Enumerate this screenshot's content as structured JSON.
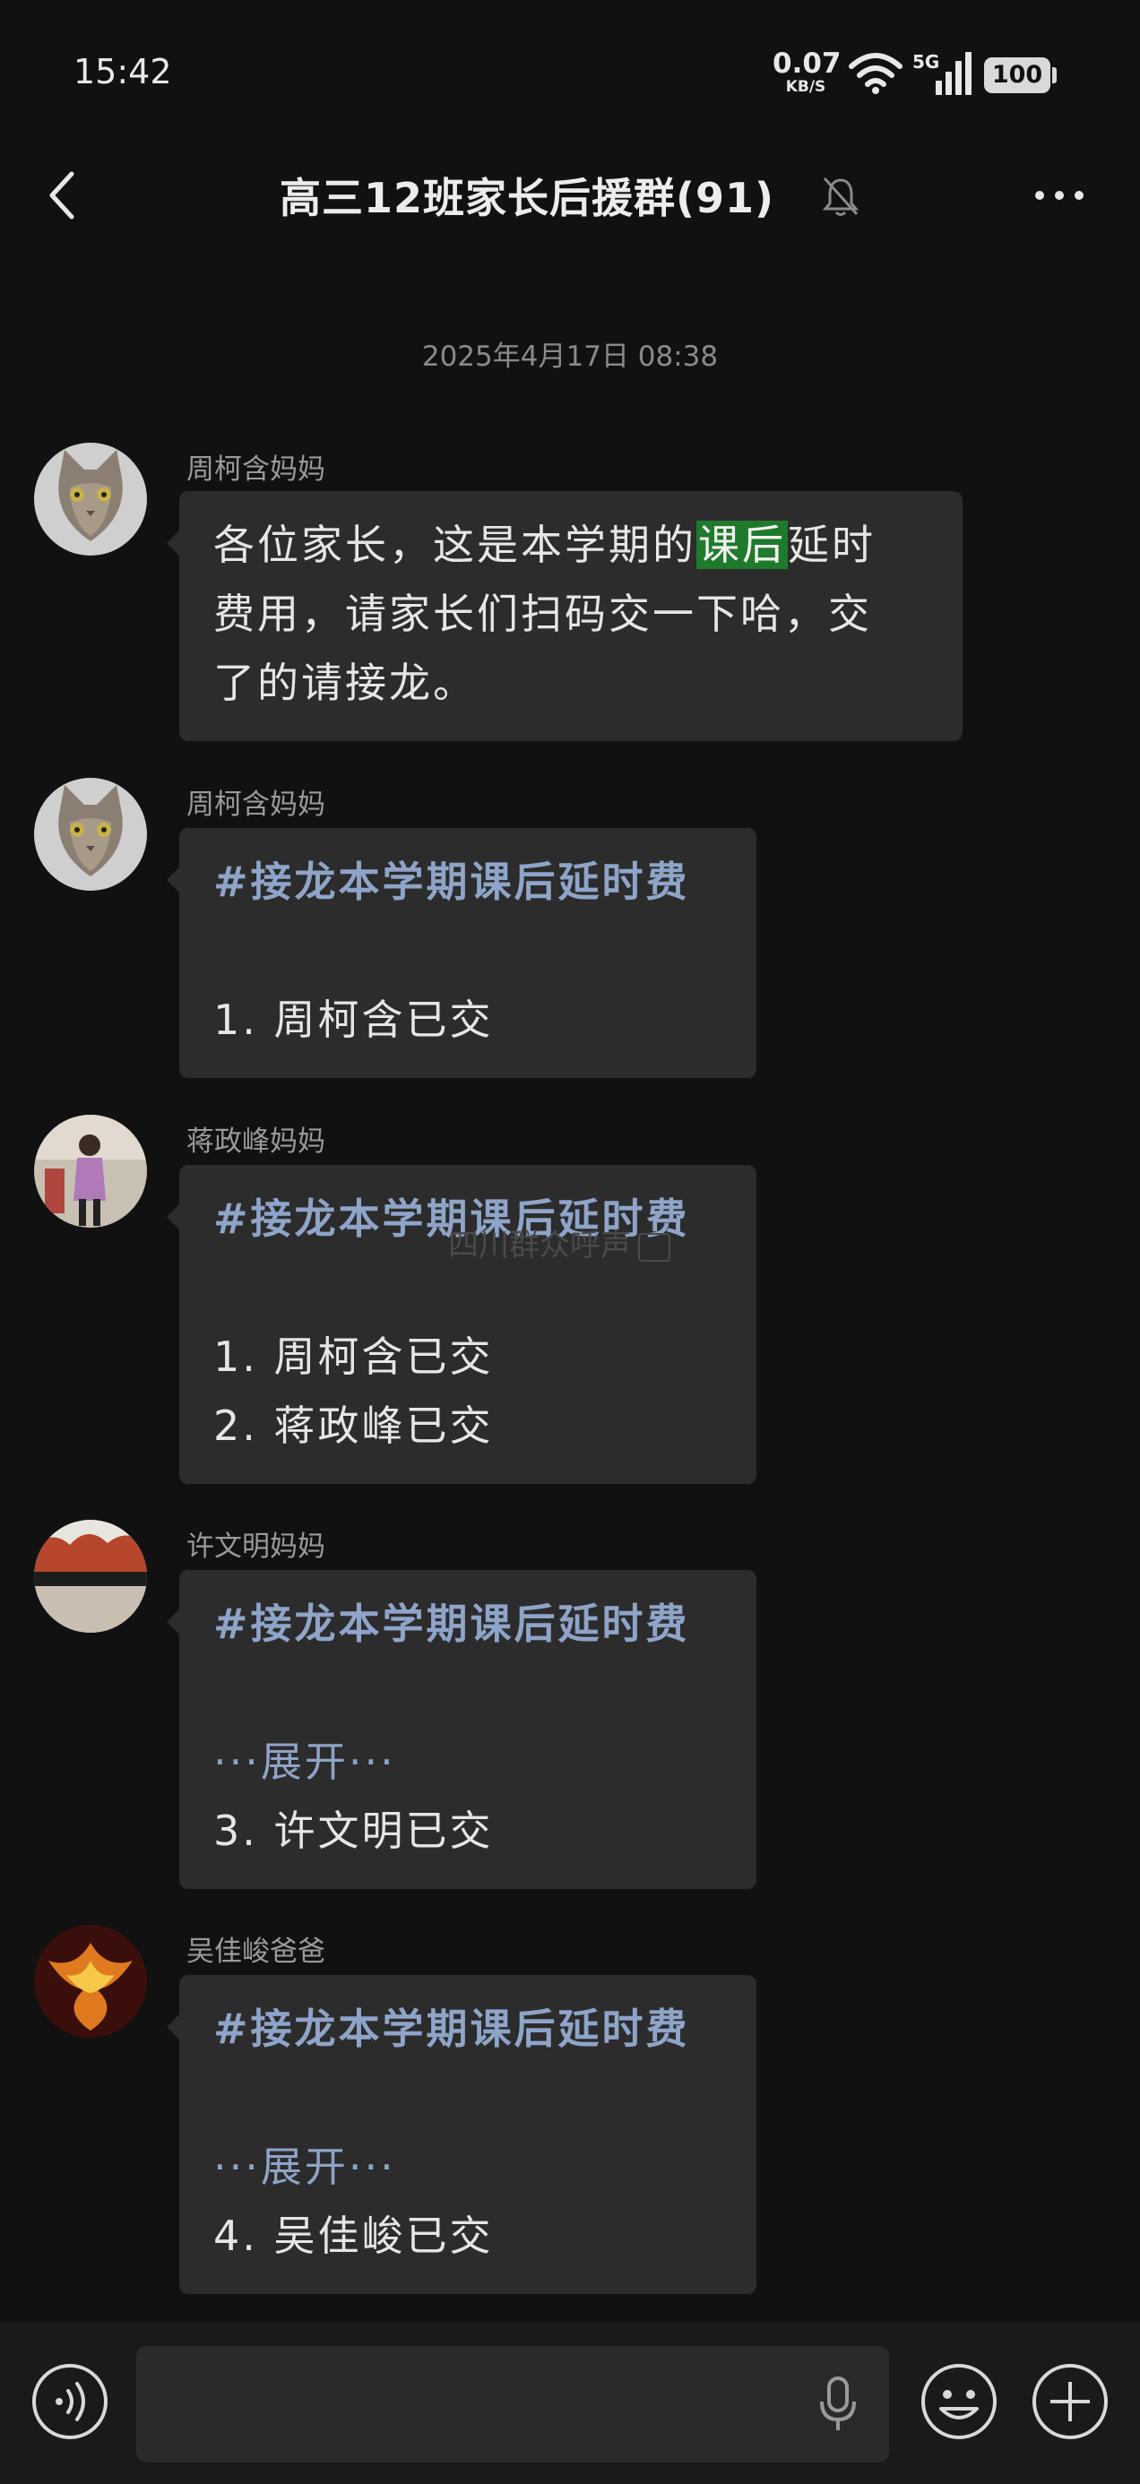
{
  "status_bar": {
    "time": "15:42",
    "net_speed_value": "0.07",
    "net_speed_unit": "KB/S",
    "signal_label": "5G",
    "battery": "100"
  },
  "header": {
    "title": "高三12班家长后援群(91)",
    "icons": [
      "back-icon",
      "mute-bell-icon",
      "more-icon"
    ]
  },
  "chat": {
    "timestamp": "2025年4月17日 08:38",
    "messages": [
      {
        "sender": "周柯含妈妈",
        "line1_pre": "各位家长，这是本学期的",
        "line1_highlight": "课后",
        "line1_post": "延时",
        "line2": "费用，请家长们扫码交一下哈，交",
        "line3": "了的请接龙。"
      },
      {
        "sender": "周柯含妈妈",
        "tag": "#接龙本学期课后延时费",
        "entries": [
          "1. 周柯含已交"
        ]
      },
      {
        "sender": "蒋政峰妈妈",
        "tag": "#接龙本学期课后延时费",
        "entries": [
          "1. 周柯含已交",
          "2. 蒋政峰已交"
        ]
      },
      {
        "sender": "许文明妈妈",
        "tag": "#接龙本学期课后延时费",
        "expand": "···展开···",
        "entries": [
          "3. 许文明已交"
        ]
      },
      {
        "sender": "吴佳峻爸爸",
        "tag": "#接龙本学期课后延时费",
        "expand": "···展开···",
        "entries": [
          "4. 吴佳峻已交"
        ]
      }
    ]
  },
  "watermark": "四川群众呼声",
  "input_bar": {
    "icons": [
      "voice-icon",
      "microphone-icon",
      "emoji-icon",
      "plus-icon"
    ]
  },
  "colors": {
    "background": "#111111",
    "bubble": "#2c2c2c",
    "tag_text": "#8ea4c8",
    "highlight": "#1f7a2c"
  }
}
